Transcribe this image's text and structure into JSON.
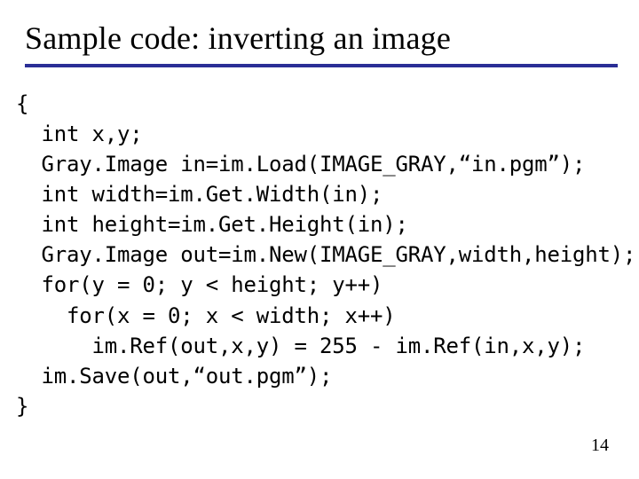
{
  "title": "Sample code: inverting an image",
  "code": {
    "l1": "{",
    "l2": "  int x,y;",
    "l3": "  Gray.Image in=im.Load(IMAGE_GRAY,“in.pgm”);",
    "l4": "  int width=im.Get.Width(in);",
    "l5": "  int height=im.Get.Height(in);",
    "l6": "  Gray.Image out=im.New(IMAGE_GRAY,width,height);",
    "l7": "  for(y = 0; y < height; y++)",
    "l8": "    for(x = 0; x < width; x++)",
    "l9": "      im.Ref(out,x,y) = 255 - im.Ref(in,x,y);",
    "l10": "  im.Save(out,“out.pgm”);",
    "l11": "}"
  },
  "page_number": "14"
}
